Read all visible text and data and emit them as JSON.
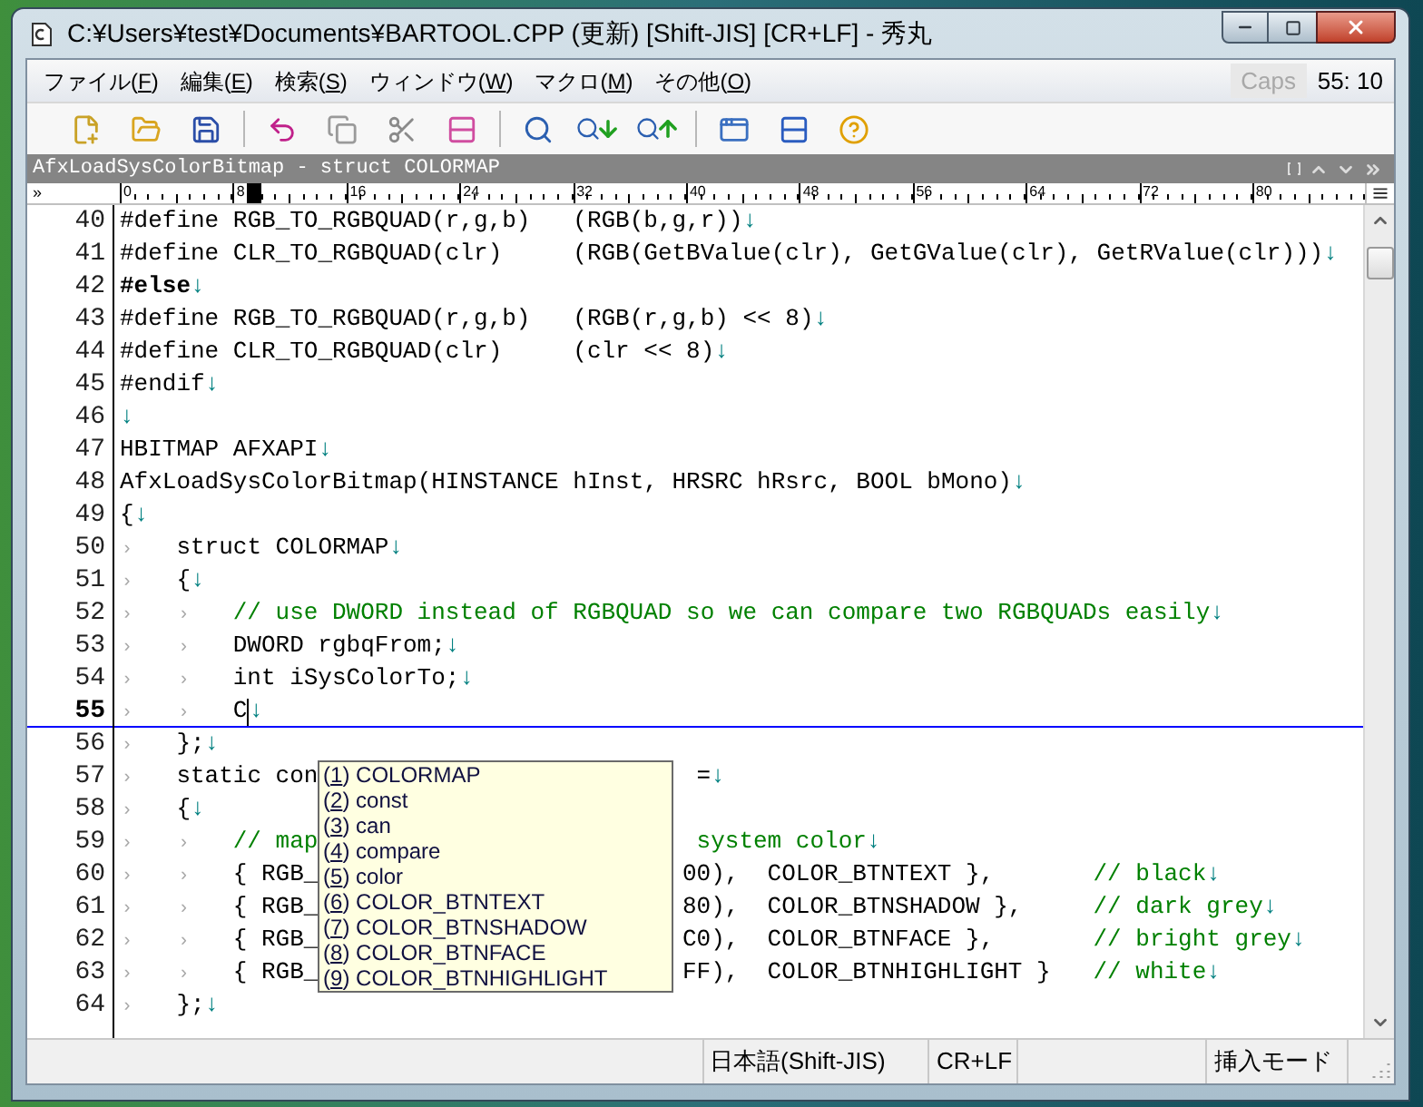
{
  "window": {
    "title": "C:¥Users¥test¥Documents¥BARTOOL.CPP (更新) [Shift-JIS] [CR+LF] - 秀丸"
  },
  "menu": [
    {
      "label": "ファイル(F)"
    },
    {
      "label": "編集(E)"
    },
    {
      "label": "検索(S)"
    },
    {
      "label": "ウィンドウ(W)"
    },
    {
      "label": "マクロ(M)"
    },
    {
      "label": "その他(O)"
    }
  ],
  "caps": {
    "label": "Caps",
    "on": false
  },
  "position": "55: 10",
  "function_bar": {
    "text": "AfxLoadSysColorBitmap - struct COLORMAP"
  },
  "ruler": {
    "lead": "»",
    "labels": [
      "0",
      "8",
      "16",
      "24",
      "32",
      "40",
      "48",
      "56",
      "64",
      "72",
      "80"
    ]
  },
  "lines": [
    {
      "number": "40",
      "current": false,
      "tokens": [
        {
          "kind": "code",
          "text": "#define RGB_TO_RGBQUAD(r,g,b)   (RGB(b,g,r))"
        },
        {
          "kind": "eol",
          "text": "↓"
        }
      ]
    },
    {
      "number": "41",
      "current": false,
      "tokens": [
        {
          "kind": "code",
          "text": "#define CLR_TO_RGBQUAD(clr)     (RGB(GetBValue(clr), GetGValue(clr), GetRValue(clr)))"
        },
        {
          "kind": "eol",
          "text": "↓"
        }
      ]
    },
    {
      "number": "42",
      "current": false,
      "tokens": [
        {
          "kind": "keyword",
          "text": "#else"
        },
        {
          "kind": "eol",
          "text": "↓"
        }
      ]
    },
    {
      "number": "43",
      "current": false,
      "tokens": [
        {
          "kind": "code",
          "text": "#define RGB_TO_RGBQUAD(r,g,b)   (RGB(r,g,b) << 8)"
        },
        {
          "kind": "eol",
          "text": "↓"
        }
      ]
    },
    {
      "number": "44",
      "current": false,
      "tokens": [
        {
          "kind": "code",
          "text": "#define CLR_TO_RGBQUAD(clr)     (clr << 8)"
        },
        {
          "kind": "eol",
          "text": "↓"
        }
      ]
    },
    {
      "number": "45",
      "current": false,
      "tokens": [
        {
          "kind": "code",
          "text": "#endif"
        },
        {
          "kind": "eol",
          "text": "↓"
        }
      ]
    },
    {
      "number": "46",
      "current": false,
      "tokens": [
        {
          "kind": "eol",
          "text": "↓"
        }
      ]
    },
    {
      "number": "47",
      "current": false,
      "tokens": [
        {
          "kind": "code",
          "text": "HBITMAP AFXAPI"
        },
        {
          "kind": "eol",
          "text": "↓"
        }
      ]
    },
    {
      "number": "48",
      "current": false,
      "tokens": [
        {
          "kind": "code",
          "text": "AfxLoadSysColorBitmap(HINSTANCE hInst, HRSRC hRsrc, BOOL bMono)"
        },
        {
          "kind": "eol",
          "text": "↓"
        }
      ]
    },
    {
      "number": "49",
      "current": false,
      "tokens": [
        {
          "kind": "code",
          "text": "{"
        },
        {
          "kind": "eol",
          "text": "↓"
        }
      ]
    },
    {
      "number": "50",
      "current": false,
      "tokens": [
        {
          "kind": "tab",
          "text": "›"
        },
        {
          "kind": "code",
          "text": "struct COLORMAP"
        },
        {
          "kind": "eol",
          "text": "↓"
        }
      ]
    },
    {
      "number": "51",
      "current": false,
      "tokens": [
        {
          "kind": "tab",
          "text": "›"
        },
        {
          "kind": "code",
          "text": "{"
        },
        {
          "kind": "eol",
          "text": "↓"
        }
      ]
    },
    {
      "number": "52",
      "current": false,
      "tokens": [
        {
          "kind": "tab",
          "text": "›"
        },
        {
          "kind": "tab",
          "text": "›"
        },
        {
          "kind": "comment",
          "text": "// use DWORD instead of RGBQUAD so we can compare two RGBQUADs easily"
        },
        {
          "kind": "eol",
          "text": "↓"
        }
      ]
    },
    {
      "number": "53",
      "current": false,
      "tokens": [
        {
          "kind": "tab",
          "text": "›"
        },
        {
          "kind": "tab",
          "text": "›"
        },
        {
          "kind": "code",
          "text": "DWORD rgbqFrom;"
        },
        {
          "kind": "eol",
          "text": "↓"
        }
      ]
    },
    {
      "number": "54",
      "current": false,
      "tokens": [
        {
          "kind": "tab",
          "text": "›"
        },
        {
          "kind": "tab",
          "text": "›"
        },
        {
          "kind": "code",
          "text": "int iSysColorTo;"
        },
        {
          "kind": "eol",
          "text": "↓"
        }
      ]
    },
    {
      "number": "55",
      "current": true,
      "tokens": [
        {
          "kind": "tab",
          "text": "›"
        },
        {
          "kind": "tab",
          "text": "›"
        },
        {
          "kind": "code",
          "text": "C"
        },
        {
          "kind": "cursor"
        },
        {
          "kind": "eol",
          "text": "↓"
        }
      ]
    },
    {
      "number": "56",
      "current": false,
      "tokens": [
        {
          "kind": "tab",
          "text": "›"
        },
        {
          "kind": "code",
          "text": "};"
        },
        {
          "kind": "eol",
          "text": "↓"
        }
      ]
    },
    {
      "number": "57",
      "current": false,
      "tokens": [
        {
          "kind": "tab",
          "text": "›"
        },
        {
          "kind": "code",
          "text": "static con"
        }
      ],
      "after": [
        {
          "kind": "code",
          "text": " ="
        },
        {
          "kind": "eol",
          "text": "↓"
        }
      ]
    },
    {
      "number": "58",
      "current": false,
      "tokens": [
        {
          "kind": "tab",
          "text": "›"
        },
        {
          "kind": "code",
          "text": "{"
        },
        {
          "kind": "eol",
          "text": "↓"
        }
      ]
    },
    {
      "number": "59",
      "current": false,
      "tokens": [
        {
          "kind": "tab",
          "text": "›"
        },
        {
          "kind": "tab",
          "text": "›"
        },
        {
          "kind": "comment",
          "text": "// map"
        }
      ],
      "after": [
        {
          "kind": "comment",
          "text": " system color"
        },
        {
          "kind": "eol",
          "text": "↓"
        }
      ]
    },
    {
      "number": "60",
      "current": false,
      "tokens": [
        {
          "kind": "tab",
          "text": "›"
        },
        {
          "kind": "tab",
          "text": "›"
        },
        {
          "kind": "code",
          "text": "{ RGB_"
        }
      ],
      "after": [
        {
          "kind": "code",
          "text": "00),  COLOR_BTNTEXT },       "
        },
        {
          "kind": "comment",
          "text": "// black"
        },
        {
          "kind": "eol",
          "text": "↓"
        }
      ]
    },
    {
      "number": "61",
      "current": false,
      "tokens": [
        {
          "kind": "tab",
          "text": "›"
        },
        {
          "kind": "tab",
          "text": "›"
        },
        {
          "kind": "code",
          "text": "{ RGB_"
        }
      ],
      "after": [
        {
          "kind": "code",
          "text": "80),  COLOR_BTNSHADOW },     "
        },
        {
          "kind": "comment",
          "text": "// dark grey"
        },
        {
          "kind": "eol",
          "text": "↓"
        }
      ]
    },
    {
      "number": "62",
      "current": false,
      "tokens": [
        {
          "kind": "tab",
          "text": "›"
        },
        {
          "kind": "tab",
          "text": "›"
        },
        {
          "kind": "code",
          "text": "{ RGB_"
        }
      ],
      "after": [
        {
          "kind": "code",
          "text": "C0),  COLOR_BTNFACE },       "
        },
        {
          "kind": "comment",
          "text": "// bright grey"
        },
        {
          "kind": "eol",
          "text": "↓"
        }
      ]
    },
    {
      "number": "63",
      "current": false,
      "tokens": [
        {
          "kind": "tab",
          "text": "›"
        },
        {
          "kind": "tab",
          "text": "›"
        },
        {
          "kind": "code",
          "text": "{ RGB_"
        }
      ],
      "after": [
        {
          "kind": "code",
          "text": "FF),  COLOR_BTNHIGHLIGHT }   "
        },
        {
          "kind": "comment",
          "text": "// white"
        },
        {
          "kind": "eol",
          "text": "↓"
        }
      ]
    },
    {
      "number": "64",
      "current": false,
      "tokens": [
        {
          "kind": "tab",
          "text": "›"
        },
        {
          "kind": "code",
          "text": "};"
        },
        {
          "kind": "eol",
          "text": "↓"
        }
      ]
    }
  ],
  "completion": {
    "items": [
      {
        "key": "(1)",
        "label": "COLORMAP"
      },
      {
        "key": "(2)",
        "label": "const"
      },
      {
        "key": "(3)",
        "label": "can"
      },
      {
        "key": "(4)",
        "label": "compare"
      },
      {
        "key": "(5)",
        "label": "color"
      },
      {
        "key": "(6)",
        "label": "COLOR_BTNTEXT"
      },
      {
        "key": "(7)",
        "label": "COLOR_BTNSHADOW"
      },
      {
        "key": "(8)",
        "label": "COLOR_BTNFACE"
      },
      {
        "key": "(9)",
        "label": "COLOR_BTNHIGHLIGHT"
      }
    ]
  },
  "status_bar": {
    "encoding": "日本語(Shift-JIS)",
    "line_ending": "CR+LF",
    "mode": "挿入モード"
  }
}
